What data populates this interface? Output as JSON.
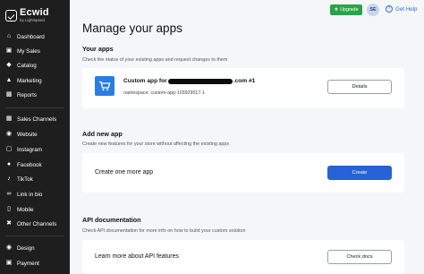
{
  "brand": {
    "name": "Ecwid",
    "sub": "by Lightspeed"
  },
  "nav": [
    {
      "label": "Dashboard",
      "icon": "home-icon"
    },
    {
      "label": "My Sales",
      "icon": "cart-icon"
    },
    {
      "label": "Catalog",
      "icon": "tag-icon"
    },
    {
      "label": "Marketing",
      "icon": "megaphone-icon"
    },
    {
      "label": "Reports",
      "icon": "chart-icon"
    },
    {
      "label": "Sales Channels",
      "icon": "channels-icon"
    },
    {
      "label": "Website",
      "icon": "globe-icon"
    },
    {
      "label": "Instagram",
      "icon": "instagram-icon"
    },
    {
      "label": "Facebook",
      "icon": "facebook-icon"
    },
    {
      "label": "TikTok",
      "icon": "tiktok-icon"
    },
    {
      "label": "Link in bio",
      "icon": "link-icon"
    },
    {
      "label": "Mobile",
      "icon": "mobile-icon"
    },
    {
      "label": "Other Channels",
      "icon": "cross-icon"
    },
    {
      "label": "Design",
      "icon": "palette-icon"
    },
    {
      "label": "Payment",
      "icon": "payment-icon"
    }
  ],
  "topbar": {
    "upgrade": "Upgrade",
    "avatar": "SE",
    "help": "Get Help",
    "help_glyph": "?"
  },
  "page": {
    "title": "Manage your apps"
  },
  "your_apps": {
    "title": "Your apps",
    "desc": "Check the status of your existing apps and request changes to them",
    "app_name_prefix": "Custom app for",
    "app_name_suffix": ".com #1",
    "namespace": "namespace: custom-app-103929017-1",
    "details_button": "Details"
  },
  "add_new": {
    "title": "Add new app",
    "desc": "Create new features for your store without affecting the existing apps",
    "card_label": "Create one more app",
    "create_button": "Create"
  },
  "api_docs": {
    "title": "API documentation",
    "desc": "Check API documentation for more info on how to build your custom solution",
    "card_label": "Learn more about API features",
    "check_button": "Check docs"
  }
}
